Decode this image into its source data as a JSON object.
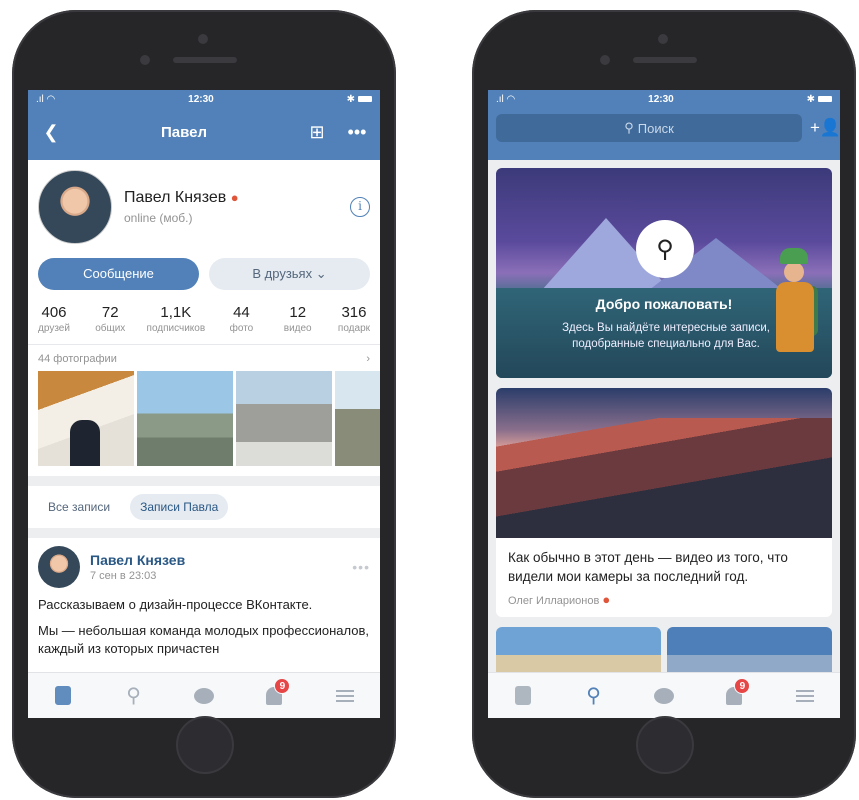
{
  "status": {
    "time": "12:30"
  },
  "profile_screen": {
    "nav_title": "Павел",
    "name": "Павел Князев",
    "online": "online (моб.)",
    "message_button": "Сообщение",
    "friends_button": "В друзьях ⌄",
    "stats": [
      {
        "value": "406",
        "label": "друзей"
      },
      {
        "value": "72",
        "label": "общих"
      },
      {
        "value": "1,1K",
        "label": "подписчиков"
      },
      {
        "value": "44",
        "label": "фото"
      },
      {
        "value": "12",
        "label": "видео"
      },
      {
        "value": "316",
        "label": "подарк"
      }
    ],
    "photos_header": "44 фотографии",
    "filters": {
      "all": "Все записи",
      "own": "Записи Павла"
    },
    "post": {
      "author": "Павел Князев",
      "date": "7 сен в 23:03",
      "text1": "Рассказываем о дизайн-процессе ВКонтакте.",
      "text2": "Мы — небольшая команда молодых профессионалов, каждый из которых причастен"
    },
    "tabbar": {
      "notif_badge": "9"
    }
  },
  "feed_screen": {
    "search_placeholder": "Поиск",
    "welcome_title": "Добро пожаловать!",
    "welcome_text": "Здесь Вы найдёте интересные записи, подобранные специально для Вас.",
    "card_text": "Как обычно в этот день — видео из того, что видели мои камеры за последний год.",
    "card_author": "Олег Илларионов",
    "tabbar": {
      "notif_badge": "9"
    }
  },
  "colors": {
    "vk_blue": "#5181b8",
    "link": "#2a5885",
    "badge": "#e64646"
  },
  "icons": [
    "back-icon",
    "gift-icon",
    "more-icon",
    "info-icon",
    "flame-icon",
    "search-icon",
    "add-user-icon",
    "news-icon",
    "messages-icon",
    "bell-icon",
    "menu-icon"
  ]
}
